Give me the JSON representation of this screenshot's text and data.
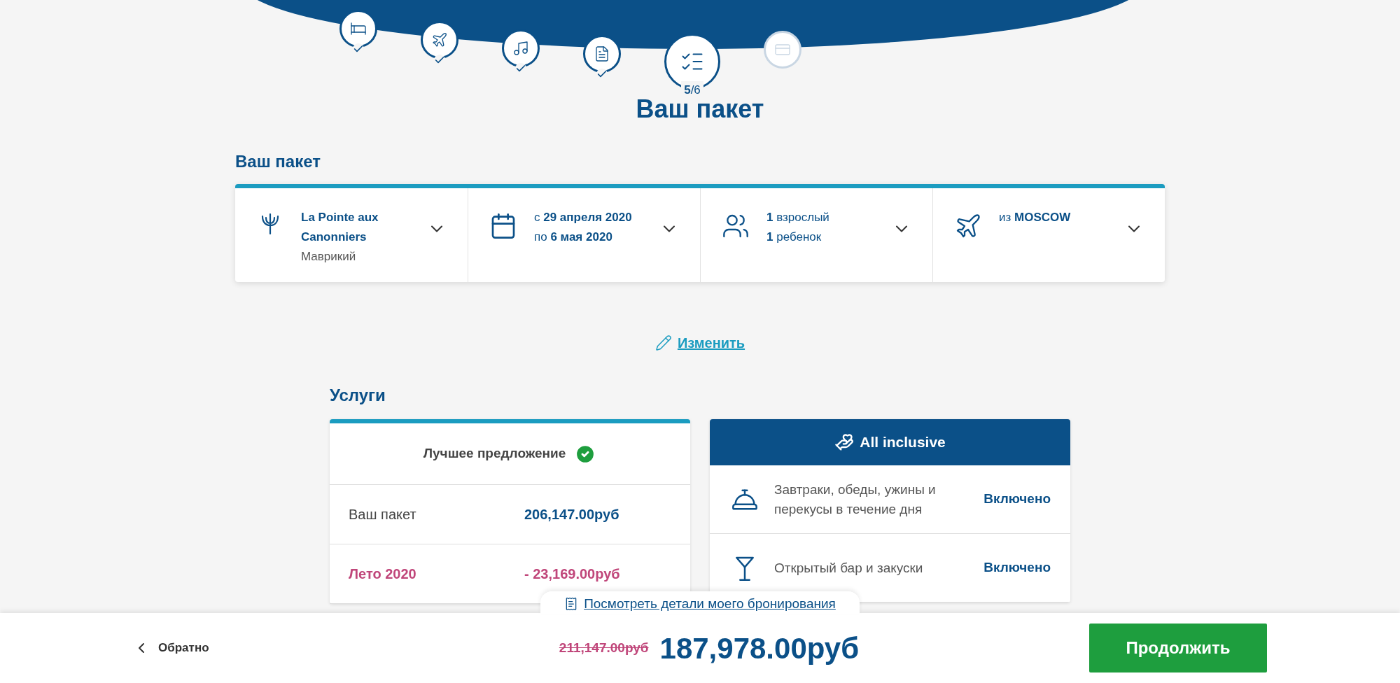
{
  "steps": [
    {
      "kind": "stay",
      "completed": true,
      "selected": false
    },
    {
      "kind": "flight",
      "completed": true,
      "selected": false
    },
    {
      "kind": "activities",
      "completed": true,
      "selected": false
    },
    {
      "kind": "travellers",
      "completed": true,
      "selected": false
    },
    {
      "kind": "summary",
      "completed": false,
      "selected": true,
      "label": "5",
      "total": "/6"
    },
    {
      "kind": "payment",
      "completed": false,
      "selected": false
    }
  ],
  "page_title": "Ваш пакет",
  "package": {
    "heading": "Ваш пакет",
    "cells": [
      {
        "kind": "resort",
        "lines": [
          "La Pointe aux",
          "Canonniers"
        ],
        "sub": "Маврикий"
      },
      {
        "kind": "dates",
        "lines": [
          "с **29 апреля 2020**",
          "по **6 мая 2020**"
        ]
      },
      {
        "kind": "people",
        "lines": [
          "**1** взрослый",
          "**1** ребенок"
        ]
      },
      {
        "kind": "departure",
        "lines": [
          "из **MOSCOW**"
        ]
      }
    ]
  },
  "edit_link": "Изменить",
  "services": {
    "heading": "Услуги",
    "offer": {
      "title": "Лучшее предложение",
      "rows": [
        {
          "kind": "base",
          "label": "Ваш пакет",
          "amount": "206,147.00руб"
        },
        {
          "kind": "discount",
          "label": "Лето 2020",
          "amount": "- 23,169.00руб"
        }
      ]
    },
    "inclusive": {
      "title": "All inclusive",
      "rows": [
        {
          "kind": "meals",
          "text": "Завтраки, обеды, ужины и перекусы в течение дня",
          "status": "Включено"
        },
        {
          "kind": "bar",
          "text": "Открытый бар и закуски",
          "status": "Включено"
        }
      ]
    }
  },
  "footer": {
    "details_link": "Посмотреть детали моего бронирования",
    "back": "Обратно",
    "old_price": "211,147.00руб",
    "price": "187,978.00руб",
    "continue": "Продолжить"
  }
}
